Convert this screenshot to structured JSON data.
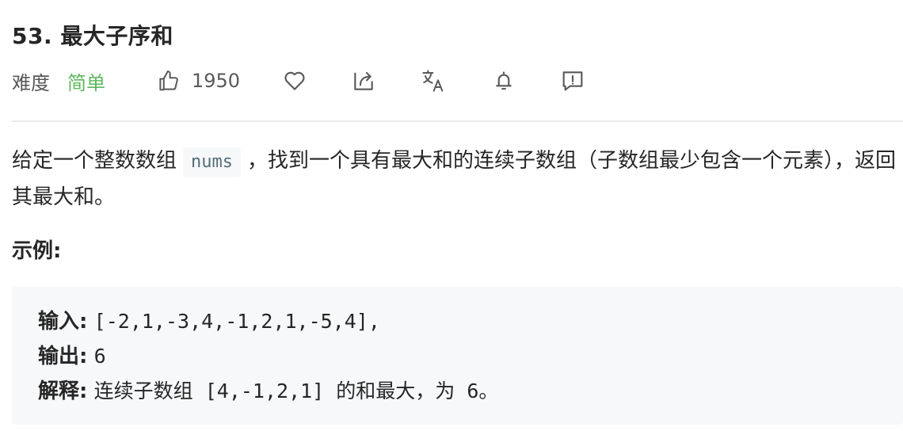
{
  "problem": {
    "title": "53. 最大子序和",
    "difficulty_label": "难度",
    "difficulty_value": "简单",
    "like_count": "1950"
  },
  "icons": {
    "like": "thumbs-up-icon",
    "favorite": "heart-icon",
    "share": "share-icon",
    "translate": "translate-icon",
    "notify": "bell-icon",
    "feedback": "feedback-icon"
  },
  "colors": {
    "difficulty_easy": "#5cb85c",
    "text": "#262626",
    "muted": "#595959",
    "code_bg": "#f7f8fa",
    "inline_code_text": "#546e7a"
  },
  "description": {
    "text_before": "给定一个整数数组",
    "inline_code": "nums",
    "text_after": "，找到一个具有最大和的连续子数组（子数组最少包含一个元素），返回其最大和。"
  },
  "example": {
    "heading": "示例:",
    "input_label": "输入:",
    "input_value": "[-2,1,-3,4,-1,2,1,-5,4],",
    "output_label": "输出:",
    "output_value": "6",
    "explain_label": "解释:",
    "explain_value": "连续子数组 [4,-1,2,1] 的和最大，为 6。"
  }
}
